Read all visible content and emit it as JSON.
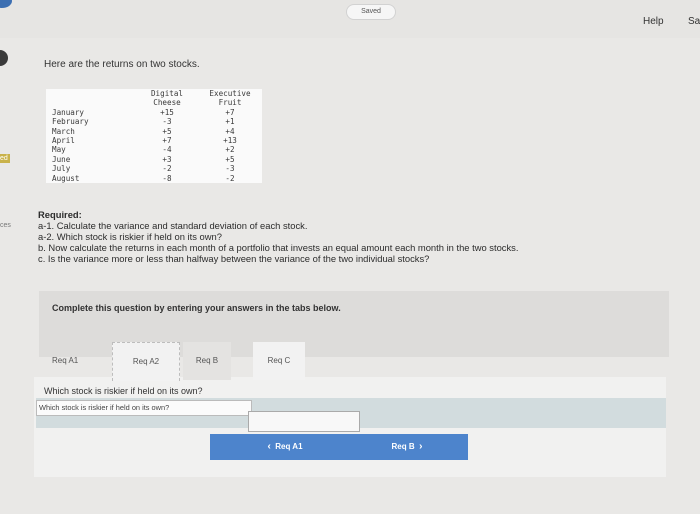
{
  "header": {
    "saved_label": "Saved",
    "help_label": "Help",
    "save_label": "Sa"
  },
  "sidebar": {
    "labels": [
      "ed",
      "ces"
    ]
  },
  "intro_text": "Here are the returns on two stocks.",
  "table": {
    "headers": [
      "Digital Cheese",
      "Executive Fruit"
    ],
    "header_lines": [
      [
        "Digital",
        "Cheese"
      ],
      [
        "Executive",
        "Fruit"
      ]
    ],
    "rows": [
      {
        "month": "January",
        "digital": "+15",
        "executive": "+7"
      },
      {
        "month": "February",
        "digital": "-3",
        "executive": "+1"
      },
      {
        "month": "March",
        "digital": "+5",
        "executive": "+4"
      },
      {
        "month": "April",
        "digital": "+7",
        "executive": "+13"
      },
      {
        "month": "May",
        "digital": "-4",
        "executive": "+2"
      },
      {
        "month": "June",
        "digital": "+3",
        "executive": "+5"
      },
      {
        "month": "July",
        "digital": "-2",
        "executive": "-3"
      },
      {
        "month": "August",
        "digital": "-8",
        "executive": "-2"
      }
    ]
  },
  "required": {
    "title": "Required:",
    "items": [
      "a-1. Calculate the variance and standard deviation of each stock.",
      "a-2. Which stock is riskier if held on its own?",
      "b. Now calculate the returns in each month of a portfolio that invests an equal amount each month in the two stocks.",
      "c. Is the variance more or less than halfway between the variance of the two individual stocks?"
    ]
  },
  "instructions": "Complete this question by entering your answers in the tabs below.",
  "tabs": [
    "Req A1",
    "Req A2",
    "Req B",
    "Req C"
  ],
  "active_tab": "Req A2",
  "question": "Which stock is riskier if held on its own?",
  "answer": {
    "label": "Which stock is riskier if held on its own?",
    "selected_value": ""
  },
  "navigation": {
    "prev_label": "Req A1",
    "next_label": "Req B"
  },
  "colors": {
    "nav_button": "#4d84cc",
    "page_background": "#e9e8e6",
    "answer_row": "#d2dcde"
  }
}
